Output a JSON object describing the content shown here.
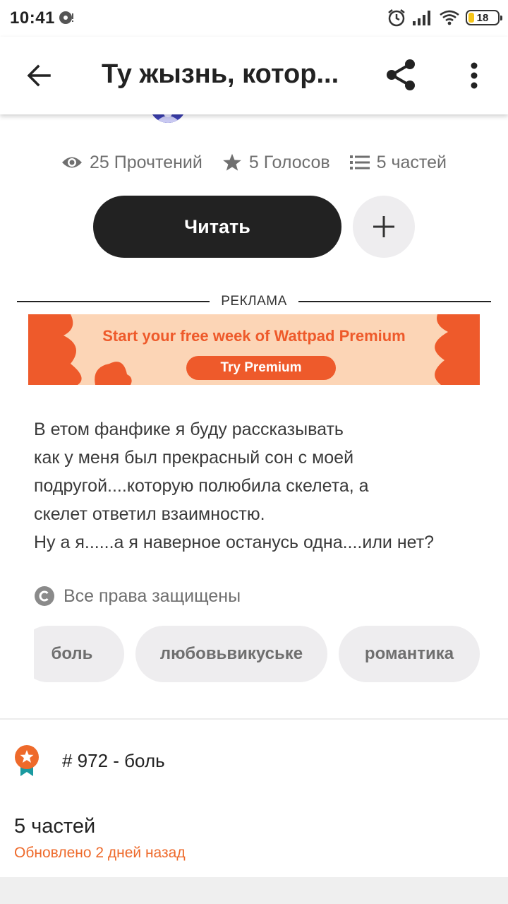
{
  "status_bar": {
    "time": "10:41",
    "battery_level": "18",
    "battery_fraction": 0.18,
    "icons": [
      "notification-icon",
      "alarm-icon",
      "signal-icon",
      "wifi-icon",
      "battery-icon"
    ]
  },
  "app_bar": {
    "title": "Ту жызнь, котор...",
    "icons": [
      "back-arrow-icon",
      "share-icon",
      "more-vert-icon"
    ]
  },
  "stats": {
    "reads": "25 Прочтений",
    "votes": "5 Голосов",
    "parts": "5 частей"
  },
  "actions": {
    "read_label": "Читать"
  },
  "ad": {
    "label": "РЕКЛАМА",
    "headline": "Start your free week of Wattpad Premium",
    "cta": "Try Premium",
    "colors": {
      "background": "#fcd5b6",
      "accent": "#ee5a2b"
    }
  },
  "description": {
    "lines": [
      "В етом фанфике я буду рассказывать",
      "как у меня был прекрасный сон с моей",
      "подругой....которую полюбила скелета, а",
      "скелет ответил взаимностю.",
      "Ну а я......а я наверное останусь одна....или нет?"
    ]
  },
  "copyright": "Все права защищены",
  "tags": [
    "боль",
    "любовьвикуське",
    "романтика"
  ],
  "rank": "# 972 - боль",
  "table_of_contents": {
    "title": "5 частей",
    "updated": "Обновлено 2 дней назад"
  },
  "colors": {
    "primary_button": "#222222",
    "accent_orange": "#ee6a2b",
    "tag_background": "#eeedef"
  }
}
